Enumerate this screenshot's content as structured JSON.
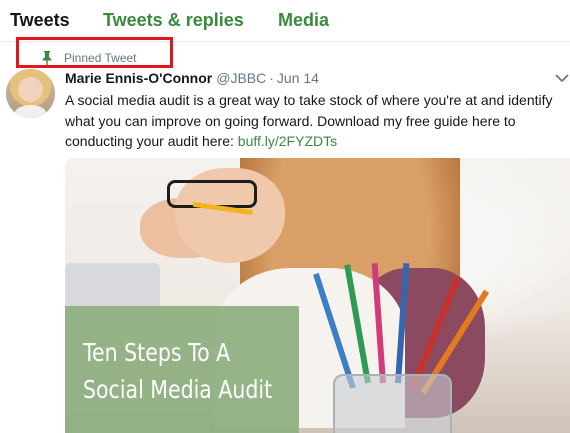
{
  "tabs": [
    {
      "label": "Tweets",
      "active": true
    },
    {
      "label": "Tweets & replies",
      "active": false
    },
    {
      "label": "Media",
      "active": false
    }
  ],
  "pinned": {
    "label": "Pinned Tweet",
    "icon": "pin-icon",
    "highlight_color": "#e0171d"
  },
  "tweet": {
    "name": "Marie Ennis-O'Connor",
    "handle": "@JBBC",
    "separator": "·",
    "date": "Jun 14",
    "text_before": "A social media audit is a great way to take stock of where you're at and identify what you can improve on going forward. Download my free guide here to conducting your audit here:",
    "link": "buff.ly/2FYZDTs",
    "media": {
      "title_line1": "Ten Steps To A",
      "title_line2": "Social Media Audit"
    }
  },
  "colors": {
    "accent": "#3a8a3c",
    "text": "#14171a",
    "muted": "#657786",
    "overlay": "#8fb082"
  }
}
